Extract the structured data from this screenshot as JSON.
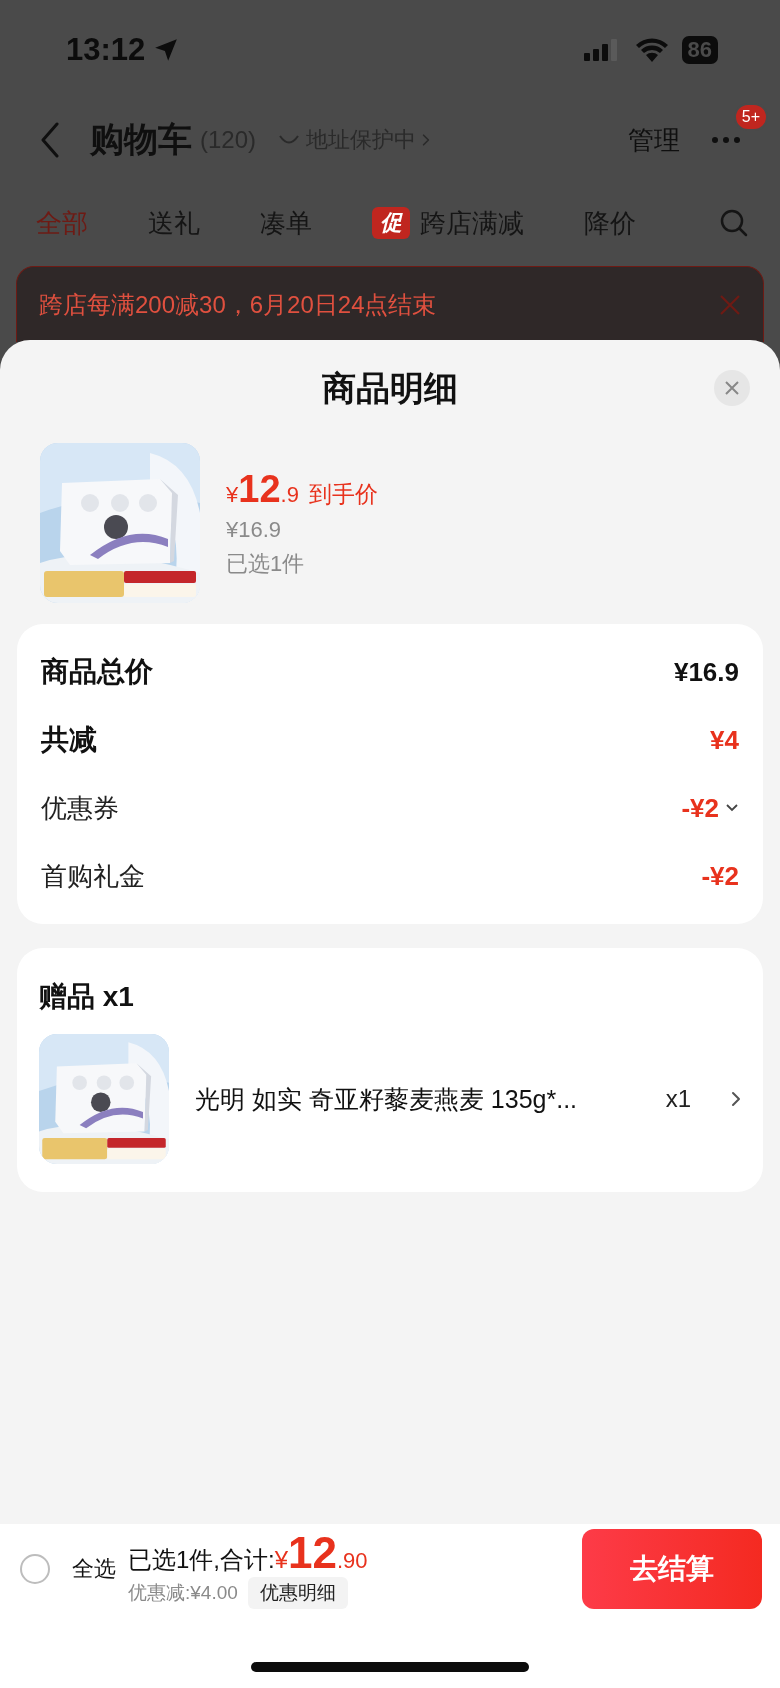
{
  "status_bar": {
    "time": "13:12",
    "battery": "86"
  },
  "nav": {
    "title": "购物车",
    "count": "(120)",
    "address_protect": "地址保护中",
    "manage": "管理",
    "more_badge": "5+"
  },
  "tabs": [
    {
      "label": "全部",
      "selected": true
    },
    {
      "label": "送礼",
      "selected": false
    },
    {
      "label": "凑单",
      "selected": false
    },
    {
      "label": "跨店满减",
      "selected": false,
      "tag": "促"
    },
    {
      "label": "降价",
      "selected": false
    }
  ],
  "promo_banner": {
    "text": "跨店每满200减30，6月20日24点结束"
  },
  "sheet": {
    "title": "商品明细",
    "product": {
      "currency": "¥",
      "price_int": "12",
      "price_dec": ".9",
      "price_label": "到手价",
      "original_price": "¥16.9",
      "selected_count": "已选1件"
    }
  },
  "summary": [
    {
      "label": "商品总价",
      "value": "¥16.9",
      "kind": "total",
      "expandable": false
    },
    {
      "label": "共减",
      "value": "¥4",
      "kind": "discount_total",
      "expandable": false
    },
    {
      "label": "优惠券",
      "value": "-¥2",
      "kind": "discount",
      "expandable": true
    },
    {
      "label": "首购礼金",
      "value": "-¥2",
      "kind": "discount",
      "expandable": false
    }
  ],
  "gifts": {
    "title": "赠品 x1",
    "items": [
      {
        "name": "光明 如实 奇亚籽藜麦燕麦 135g*...",
        "quantity": "x1"
      }
    ]
  },
  "bottom_bar": {
    "select_all": {
      "label": "全选",
      "checked": false
    },
    "summary_label": "已选1件,合计:",
    "currency": "¥",
    "total_int": "12",
    "total_dec": ".90",
    "discount": "优惠减:¥4.00",
    "detail_button": "优惠明细",
    "checkout": "去结算"
  }
}
